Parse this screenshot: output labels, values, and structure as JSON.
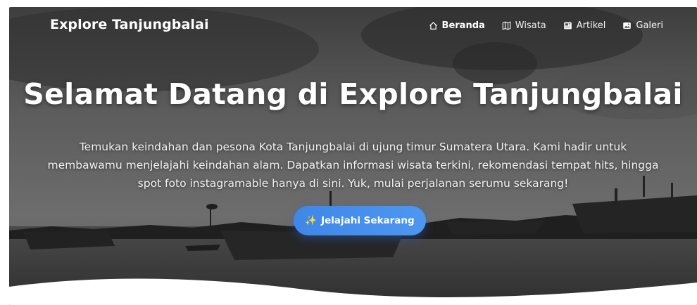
{
  "brand": "Explore Tanjungbalai",
  "nav": [
    {
      "label": "Beranda",
      "icon": "home-icon",
      "active": true
    },
    {
      "label": "Wisata",
      "icon": "map-icon",
      "active": false
    },
    {
      "label": "Artikel",
      "icon": "newspaper-icon",
      "active": false
    },
    {
      "label": "Galeri",
      "icon": "gallery-icon",
      "active": false
    }
  ],
  "hero": {
    "title": "Selamat Datang di Explore Tanjungbalai",
    "description": "Temukan keindahan dan pesona Kota Tanjungbalai di ujung timur Sumatera Utara. Kami hadir untuk membawamu menjelajahi keindahan alam. Dapatkan informasi wisata terkini, rekomendasi tempat hits, hingga spot foto instagramable hanya di sini. Yuk, mulai perjalanan serumu sekarang!",
    "cta_icon": "✨",
    "cta_label": "Jelajahi Sekarang"
  },
  "colors": {
    "accent": "#4a90e2",
    "overlay": "#3a3a3a"
  }
}
